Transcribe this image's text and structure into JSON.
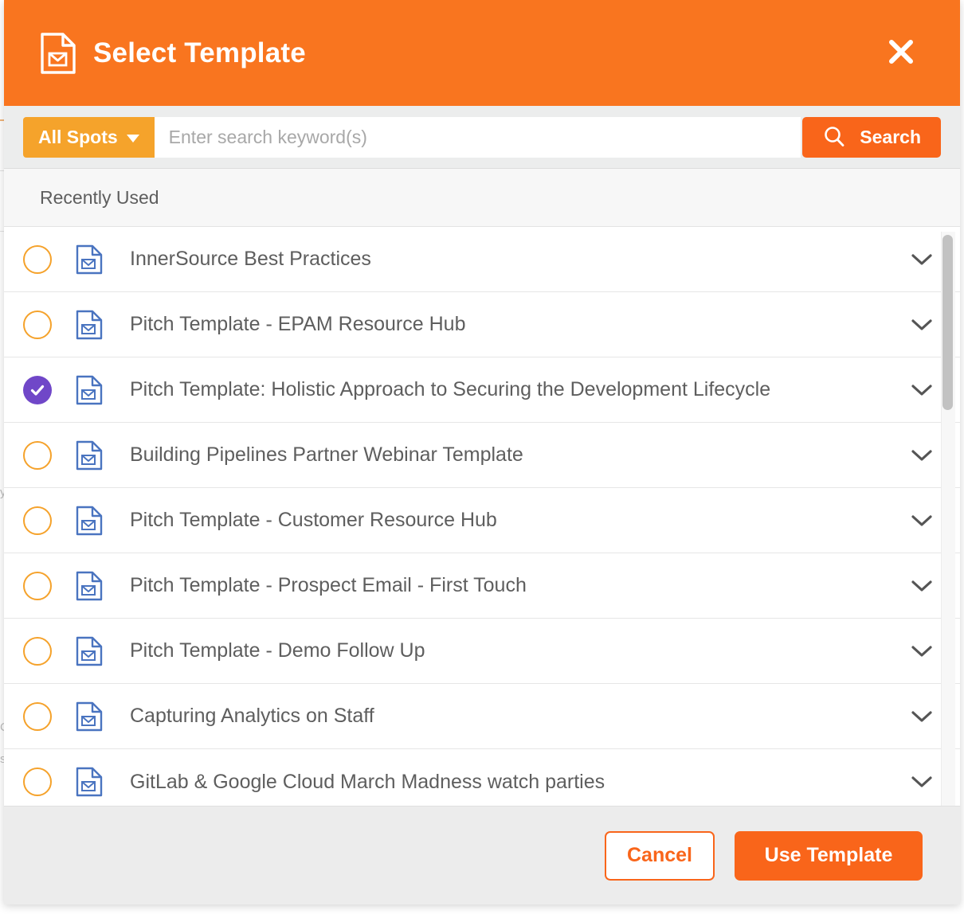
{
  "header": {
    "title": "Select Template",
    "icon": "document-email-icon",
    "close_icon": "close-icon",
    "background_color": "#f9751f"
  },
  "search": {
    "scope_label": "All Spots",
    "scope_icon": "chevron-down-icon",
    "placeholder": "Enter search keyword(s)",
    "value": "",
    "search_button_label": "Search",
    "search_icon": "search-icon",
    "scope_color": "#f5a32b",
    "button_color": "#f9651a"
  },
  "list": {
    "section_label": "Recently Used",
    "row_icon": "document-email-icon",
    "row_expand_icon": "chevron-down-icon",
    "radio_color": "#f5a22b",
    "selected_color": "#7047c8",
    "items": [
      {
        "title": "InnerSource Best Practices",
        "selected": false
      },
      {
        "title": "Pitch Template - EPAM Resource Hub",
        "selected": false
      },
      {
        "title": "Pitch Template: Holistic Approach to Securing the Development Lifecycle",
        "selected": true
      },
      {
        "title": "Building Pipelines Partner Webinar Template",
        "selected": false
      },
      {
        "title": "Pitch Template - Customer Resource Hub",
        "selected": false
      },
      {
        "title": "Pitch Template - Prospect Email - First Touch",
        "selected": false
      },
      {
        "title": "Pitch Template - Demo Follow Up",
        "selected": false
      },
      {
        "title": "Capturing Analytics on Staff",
        "selected": false
      },
      {
        "title": "GitLab & Google Cloud March Madness watch parties",
        "selected": false
      }
    ]
  },
  "footer": {
    "cancel_label": "Cancel",
    "use_template_label": "Use Template"
  }
}
